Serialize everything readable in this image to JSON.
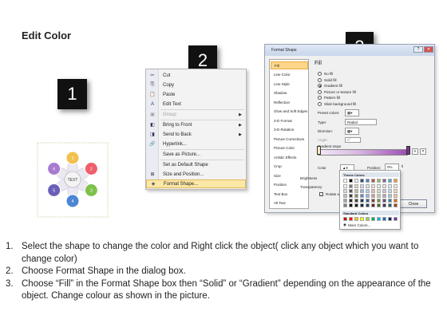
{
  "page_title": "Edit Color",
  "badges": [
    "1",
    "2",
    "3"
  ],
  "diagram": {
    "center_label": "TEXT",
    "petals": [
      {
        "label": "1",
        "color": "#f2c14e"
      },
      {
        "label": "2",
        "color": "#ef5f6a"
      },
      {
        "label": "3",
        "color": "#7ec24a"
      },
      {
        "label": "4",
        "color": "#4c86d4"
      },
      {
        "label": "5",
        "color": "#6a5fb8"
      },
      {
        "label": "6",
        "color": "#a77bd0"
      }
    ]
  },
  "context_menu": {
    "items": [
      {
        "label": "Cut",
        "icon": "scissors-icon",
        "glyph": "✂",
        "enabled": true
      },
      {
        "label": "Copy",
        "icon": "copy-icon",
        "glyph": "⎘",
        "enabled": true
      },
      {
        "label": "Paste",
        "icon": "paste-icon",
        "glyph": "📋",
        "enabled": true
      },
      {
        "label": "Edit Text",
        "icon": "edit-text-icon",
        "glyph": "A",
        "enabled": true
      },
      {
        "label": "Group",
        "icon": "group-icon",
        "glyph": "▣",
        "enabled": false,
        "submenu": true
      },
      {
        "label": "Bring to Front",
        "icon": "bring-front-icon",
        "glyph": "◧",
        "enabled": true,
        "submenu": true
      },
      {
        "label": "Send to Back",
        "icon": "send-back-icon",
        "glyph": "◨",
        "enabled": true,
        "submenu": true
      },
      {
        "label": "Hyperlink...",
        "icon": "hyperlink-icon",
        "glyph": "🔗",
        "enabled": true
      },
      {
        "label": "Save as Picture...",
        "icon": "",
        "glyph": "",
        "enabled": true
      },
      {
        "label": "Set as Default Shape",
        "icon": "",
        "glyph": "",
        "enabled": true
      },
      {
        "label": "Size and Position...",
        "icon": "size-icon",
        "glyph": "⊞",
        "enabled": true
      },
      {
        "label": "Format Shape...",
        "icon": "format-shape-icon",
        "glyph": "◈",
        "enabled": true,
        "highlighted": true
      }
    ]
  },
  "format_dialog": {
    "title": "Format Shape",
    "categories": [
      "Fill",
      "Line Color",
      "Line Style",
      "Shadow",
      "Reflection",
      "Glow and Soft Edges",
      "3-D Format",
      "3-D Rotation",
      "Picture Corrections",
      "Picture Color",
      "Artistic Effects",
      "Crop",
      "Size",
      "Position",
      "Text Box",
      "Alt Text"
    ],
    "selected_category": "Fill",
    "fill_heading": "Fill",
    "fill_options": [
      {
        "label": "No fill",
        "selected": false
      },
      {
        "label": "Solid fill",
        "selected": false
      },
      {
        "label": "Gradient fill",
        "selected": true
      },
      {
        "label": "Picture or texture fill",
        "selected": false
      },
      {
        "label": "Pattern fill",
        "selected": false
      },
      {
        "label": "Slide background fill",
        "selected": false
      }
    ],
    "preset_colors_label": "Preset colors:",
    "type_label": "Type:",
    "type_value": "Radial",
    "direction_label": "Direction:",
    "angle_label": "Angle:",
    "angle_value": "0°",
    "gradient_stops_label": "Gradient stops",
    "color_label": "Color",
    "position_label": "Position:",
    "position_value": "0%",
    "brightness_label": "Brightness",
    "transparency_label": "Transparency",
    "rotate_label": "Rotate with shape",
    "close_label": "Close"
  },
  "palette": {
    "theme_header": "Theme Colors",
    "standard_header": "Standard Colors",
    "more_colors": "More Colors...",
    "theme_top": [
      "#ffffff",
      "#000000",
      "#eeece1",
      "#1f497d",
      "#4f81bd",
      "#c0504d",
      "#9bbb59",
      "#8064a2",
      "#4bacc6",
      "#f79646"
    ],
    "theme_shade_rows": [
      [
        "#f2f2f2",
        "#7f7f7f",
        "#ddd9c3",
        "#c6d9f0",
        "#dbe5f1",
        "#f2dcdb",
        "#ebf1dd",
        "#e5e0ec",
        "#dbeef3",
        "#fdeada"
      ],
      [
        "#d8d8d8",
        "#595959",
        "#c4bd97",
        "#8db3e2",
        "#b8cce4",
        "#e5b9b7",
        "#d7e3bc",
        "#ccc1d9",
        "#b7dde8",
        "#fbd5b5"
      ],
      [
        "#bfbfbf",
        "#3f3f3f",
        "#938953",
        "#548dd4",
        "#95b3d7",
        "#d99694",
        "#c3d69b",
        "#b2a2c7",
        "#92cddc",
        "#fac08f"
      ],
      [
        "#a5a5a5",
        "#262626",
        "#494429",
        "#17365d",
        "#366092",
        "#953734",
        "#76923c",
        "#5f497a",
        "#31859b",
        "#e36c09"
      ],
      [
        "#7f7f7f",
        "#0c0c0c",
        "#1d1b10",
        "#0f243e",
        "#244061",
        "#632423",
        "#4f6128",
        "#3f3151",
        "#205867",
        "#974806"
      ]
    ],
    "standard": [
      "#c00000",
      "#ff0000",
      "#ffc000",
      "#ffff00",
      "#92d050",
      "#00b050",
      "#00b0f0",
      "#0070c0",
      "#002060",
      "#7030a0"
    ]
  },
  "instructions": [
    {
      "num": "1.",
      "text": "Select the shape to change the color and Right click the object( click any object which you want to change color)"
    },
    {
      "num": "2.",
      "text": "Choose Format Shape in the dialog box."
    },
    {
      "num": "3.",
      "text": "Choose “Fill” in the Format Shape box then “Solid” or “Gradient” depending on the appearance of the object. Change colour as shown in the picture."
    }
  ]
}
